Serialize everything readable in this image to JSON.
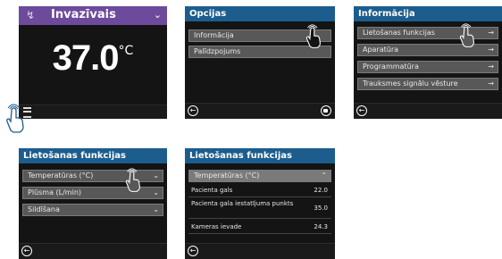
{
  "screen1": {
    "mode_title": "Invazīvais",
    "temperature_value": "37.0",
    "temperature_unit": "°C",
    "mode_color": "#6d4a9c"
  },
  "screen2": {
    "title": "Opcijas",
    "items": [
      "Informācija",
      "Palīdzpojums"
    ]
  },
  "screen3": {
    "title": "Informācija",
    "items": [
      "Lietošanas funkcijas",
      "Aparatūra",
      "Programmatūra",
      "Trauksmes signālu vēsture"
    ]
  },
  "screen4": {
    "title": "Lietošanas funkcijas",
    "items": [
      "Temperatūras (°C)",
      "Plūsma (L/min)",
      "Sildīšana"
    ]
  },
  "screen5": {
    "title": "Lietošanas funkcijas",
    "section": "Temperatūras (°C)",
    "rows": [
      {
        "label": "Pacienta gals",
        "value": "22.0"
      },
      {
        "label": "Pacienta gala iestatījuma punkts",
        "value": "35.0"
      },
      {
        "label": "Kameras ievade",
        "value": "24.3"
      }
    ]
  },
  "icons": {
    "back": "back-arrow-icon",
    "lock": "lock-icon",
    "menu": "menu-icon",
    "touch": "tap-hand-icon"
  }
}
